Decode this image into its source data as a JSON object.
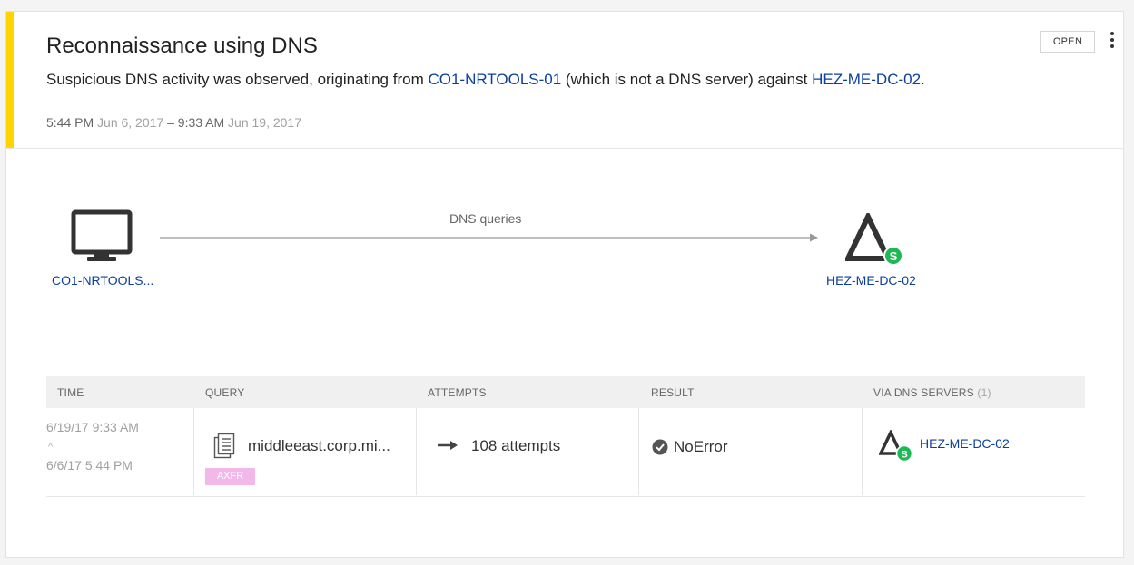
{
  "alert": {
    "title": "Reconnaissance using DNS",
    "desc_prefix": "Suspicious DNS activity was observed, originating from ",
    "source_host": "CO1-NRTOOLS-01",
    "desc_middle": " (which is not a DNS server) against ",
    "target_host": "HEZ-ME-DC-02",
    "desc_suffix": ".",
    "status": "OPEN",
    "accent_color": "#ffd400"
  },
  "timeline": {
    "start_time": "5:44 PM",
    "start_date": "Jun 6, 2017",
    "separator": "–",
    "end_time": "9:33 AM",
    "end_date": "Jun 19, 2017"
  },
  "diagram": {
    "source_label": "CO1-NRTOOLS...",
    "source_icon": "monitor-icon",
    "edge_label": "DNS queries",
    "target_label": "HEZ-ME-DC-02",
    "target_icon": "domain-controller-icon",
    "target_badge_icon": "sensor-badge-icon",
    "badge_color": "#1db954"
  },
  "table": {
    "columns": {
      "time": "TIME",
      "query": "QUERY",
      "attempts": "ATTEMPTS",
      "result": "RESULT",
      "via": "VIA DNS SERVERS",
      "via_count": "(1)"
    },
    "rows": [
      {
        "time_end": "6/19/17 9:33 AM",
        "time_start": "6/6/17 5:44 PM",
        "query": "middleeast.corp.mi...",
        "query_type": "AXFR",
        "attempts": "108 attempts",
        "result": "NoError",
        "via_server": "HEZ-ME-DC-02"
      }
    ]
  }
}
